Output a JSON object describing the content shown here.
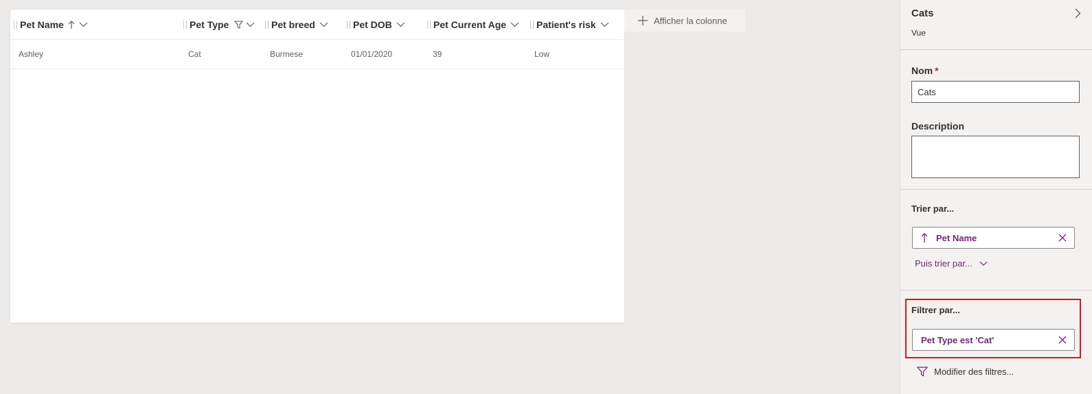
{
  "grid": {
    "columns": [
      {
        "label": "Pet Name",
        "sort": "asc",
        "filter": false
      },
      {
        "label": "Pet Type",
        "sort": "",
        "filter": true
      },
      {
        "label": "Pet breed",
        "sort": "",
        "filter": false
      },
      {
        "label": "Pet DOB",
        "sort": "",
        "filter": false
      },
      {
        "label": "Pet Current Age",
        "sort": "",
        "filter": false
      },
      {
        "label": "Patient's risk",
        "sort": "",
        "filter": false
      }
    ],
    "rows": [
      {
        "pet_name": "Ashley",
        "pet_type": "Cat",
        "pet_breed": "Burmese",
        "pet_dob": "01/01/2020",
        "pet_age": "39",
        "risk": "Low"
      }
    ],
    "show_column_label": "Afficher la colonne"
  },
  "panel": {
    "title": "Cats",
    "subtitle": "Vue",
    "name_label": "Nom",
    "name_required": "*",
    "name_value": "Cats",
    "description_label": "Description",
    "description_value": "",
    "sort_label": "Trier par...",
    "sort_field": "Pet Name",
    "then_sort_label": "Puis trier par...",
    "filter_label": "Filtrer par...",
    "filter_value": "Pet Type est 'Cat'",
    "edit_filters_label": "Modifier des filtres..."
  },
  "colors": {
    "accent": "#742774",
    "highlight_border": "#e0101a",
    "panel_bg": "#f3f2f1",
    "canvas_bg": "#edebe9"
  }
}
